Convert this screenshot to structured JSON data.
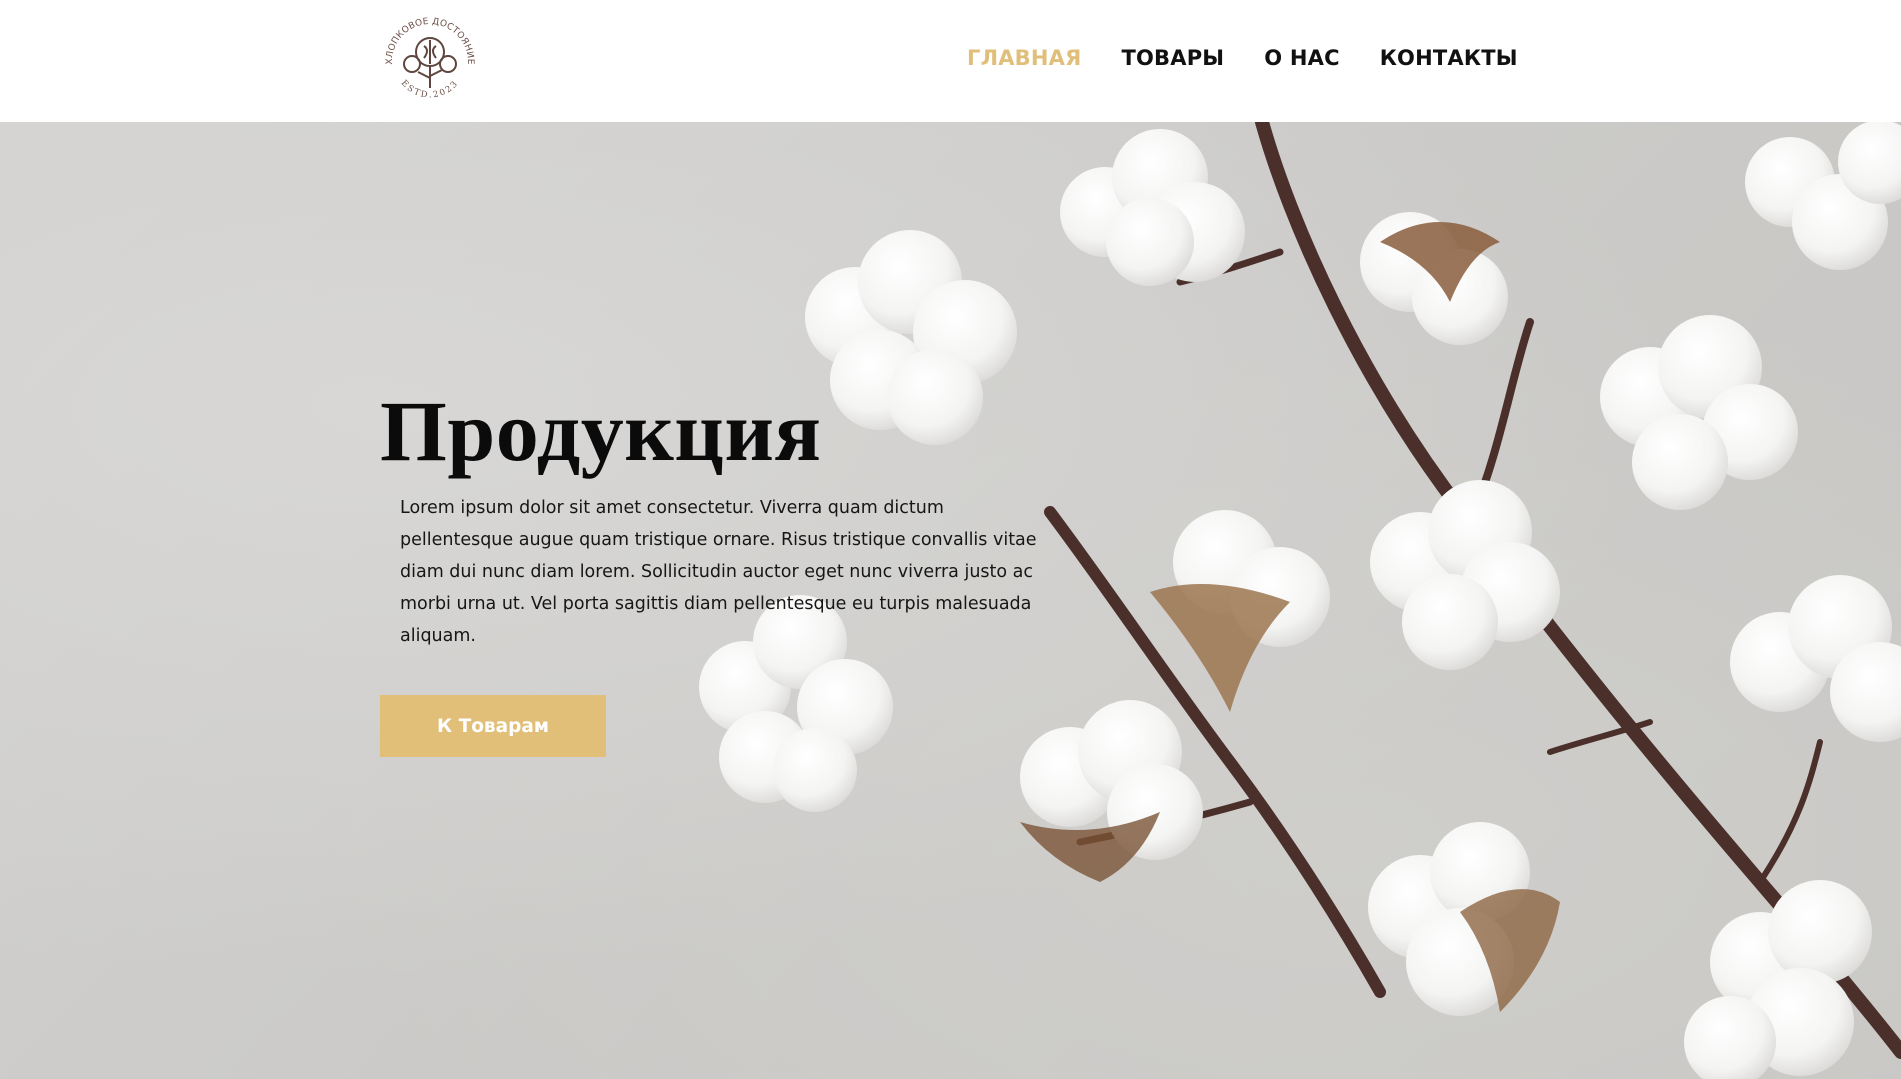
{
  "logo": {
    "arc_text": "ХЛОПКОВОЕ ДОСТОЯНИЕ",
    "estd_text": "ESTD.2023",
    "icon": "cotton-branch-icon"
  },
  "nav": {
    "items": [
      {
        "label": "ГЛАВНАЯ",
        "active": true
      },
      {
        "label": "ТОВАРЫ",
        "active": false
      },
      {
        "label": "О НАС",
        "active": false
      },
      {
        "label": "КОНТАКТЫ",
        "active": false
      }
    ]
  },
  "hero": {
    "title": "Продукция",
    "text": "Lorem ipsum dolor sit amet consectetur. Viverra quam dictum pellentesque augue quam tristique ornare. Risus tristique convallis vitae diam dui nunc diam lorem. Sollicitudin auctor eget nunc viverra justo ac morbi urna ut. Vel porta sagittis diam pellentesque eu turpis malesuada aliquam.",
    "button_label": "К Товарам",
    "background_image": "cotton-flowers-photo"
  },
  "colors": {
    "accent": "#e1bf78",
    "nav_active": "#e0bf7a",
    "text": "#111111",
    "hero_bg": "#cfcecc",
    "logo_brown": "#6b4e45"
  }
}
